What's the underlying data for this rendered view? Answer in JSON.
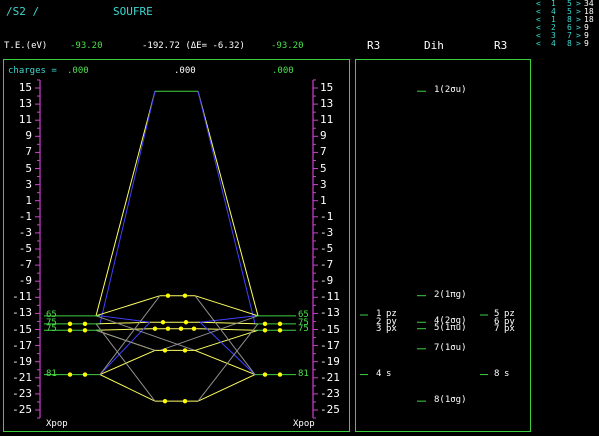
{
  "header": {
    "molecule": "/S2 /",
    "name": "SOUFRE",
    "te_label": "T.E.(eV)",
    "te_left": "-93.20",
    "te_center": "-192.72 (ΔE= -6.32)",
    "te_right": "-93.20"
  },
  "symmetry": {
    "left": "R3",
    "center": "Dih",
    "right": "R3"
  },
  "charges": {
    "label": "charges =",
    "left": ".000",
    "center": ".000",
    "right": ".000"
  },
  "xpop": {
    "left": "Xpop",
    "right": "Xpop"
  },
  "interactions": [
    {
      "a": "1",
      "b": "5",
      "v": "34"
    },
    {
      "a": "4",
      "b": "5",
      "v": "18"
    },
    {
      "a": "1",
      "b": "8",
      "v": "18"
    },
    {
      "a": "2",
      "b": "6",
      "v": "9"
    },
    {
      "a": "3",
      "b": "7",
      "v": "9"
    },
    {
      "a": "4",
      "b": "8",
      "v": "9"
    }
  ],
  "energy_axis": {
    "ticks": [
      15,
      13,
      11,
      9,
      7,
      5,
      3,
      1,
      -1,
      -3,
      -5,
      -7,
      -9,
      -11,
      -13,
      -15,
      -17,
      -19,
      -21,
      -23,
      -25
    ],
    "range": [
      -26,
      16
    ]
  },
  "populations": {
    "left": [
      {
        "label": "65",
        "e": -13.3
      },
      {
        "label": "75",
        "e": -14.3
      },
      {
        "label": "75",
        "e": -15.1
      },
      {
        "label": "81",
        "e": -20.6
      }
    ],
    "right": [
      {
        "label": "65",
        "e": -13.3
      },
      {
        "label": "75",
        "e": -14.3
      },
      {
        "label": "75",
        "e": -15.1
      },
      {
        "label": "81",
        "e": -20.6
      }
    ]
  },
  "atom_orbitals": {
    "left": [
      {
        "num": "1",
        "label": "pz",
        "e": -13.2
      },
      {
        "num": "2",
        "label": "py",
        "e": -14.2
      },
      {
        "num": "3",
        "label": "px",
        "e": -15.0
      },
      {
        "num": "4",
        "label": "s",
        "e": -20.6
      }
    ],
    "right": [
      {
        "num": "5",
        "label": "pz",
        "e": -13.2
      },
      {
        "num": "6",
        "label": "py",
        "e": -14.2
      },
      {
        "num": "7",
        "label": "px",
        "e": -15.0
      },
      {
        "num": "8",
        "label": "s",
        "e": -20.6
      }
    ]
  },
  "mo_levels": [
    {
      "label": "1(2σu)",
      "e": 14.6
    },
    {
      "label": "2(1πg)",
      "e": -10.8
    },
    {
      "label": "4(2σg)",
      "e": -14.1
    },
    {
      "label": "5(1πu)",
      "e": -14.9
    },
    {
      "label": "7(1σu)",
      "e": -17.4
    },
    {
      "label": "8(1σg)",
      "e": -23.9
    }
  ],
  "colors": {
    "frame": "#3ad03a",
    "axis": "#d040d0",
    "yellow_lines": "#ffff60",
    "blue_lines": "#4040ff",
    "gray_lines": "#909090",
    "green_levels": "#40d040",
    "dots": "#ffff00"
  }
}
